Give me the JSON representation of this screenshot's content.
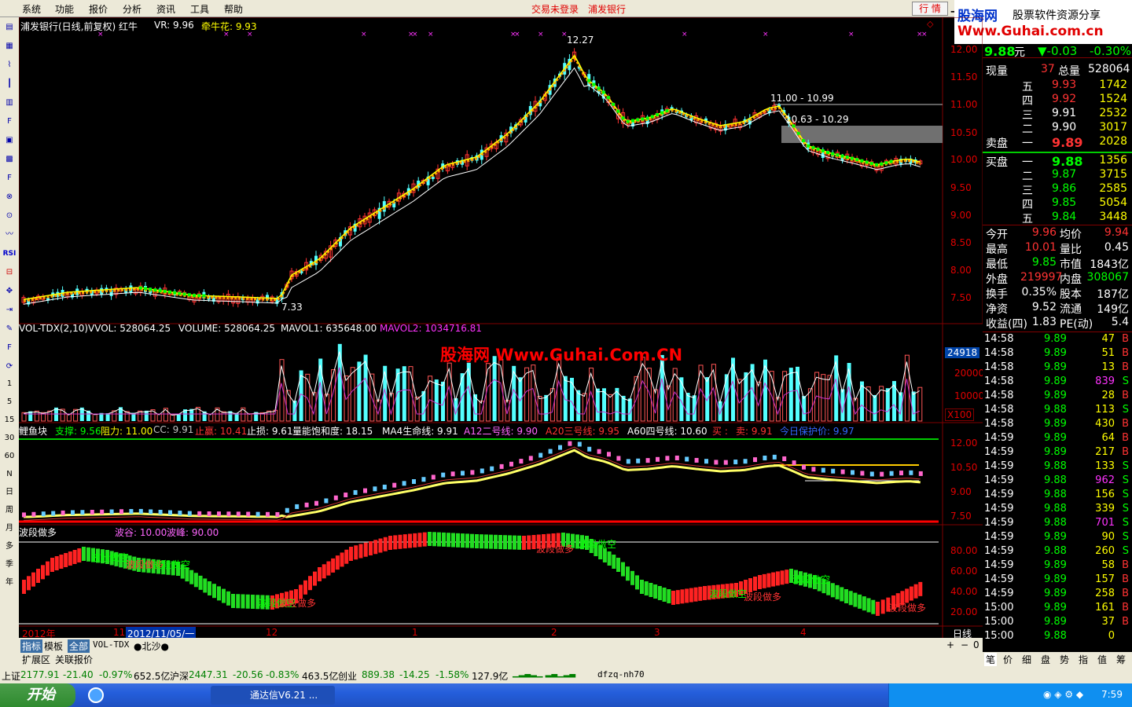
{
  "menu": {
    "items": [
      "系统",
      "功能",
      "报价",
      "分析",
      "资讯",
      "工具",
      "帮助"
    ],
    "status1": "交易未登录",
    "status2": "浦发银行",
    "hq": "行 情"
  },
  "logo": {
    "name": "股海网",
    "slogan": "股票软件资源分享",
    "url": "Www.Guhai.com.cn"
  },
  "left_toolbar": {
    "rsi": "RSI",
    "periods": [
      "1",
      "5",
      "15",
      "30",
      "60",
      "N",
      "日",
      "周",
      "月",
      "多",
      "季",
      "年"
    ]
  },
  "chart": {
    "title": "浦发银行(日线,前复权) 红牛",
    "vr": "VR: 9.96",
    "qnh": "牵牛花: 9.93",
    "price_axis": [
      "12.00",
      "11.50",
      "11.00",
      "10.50",
      "10.00",
      "9.50",
      "9.00",
      "8.50",
      "8.00",
      "7.50"
    ],
    "high_label": "12.27",
    "low_label": "7.33",
    "level1": "11.00 - 10.99",
    "level2": "10.63 - 10.29",
    "vol_header": [
      "VOL-TDX(2,10)",
      "VVOL: 528064.25",
      "VOLUME: 528064.25",
      "MAVOL1: 635648.00",
      "MAVOL2: 1034716.81"
    ],
    "vol_axis": [
      "20000",
      "10000"
    ],
    "vol_cur": "24918",
    "vol_unit": "X100",
    "watermark": "股海网 Www.Guhai.Com.CN",
    "ind_header": [
      "鲤鱼块",
      "支撑: 9.56",
      "阻力: 11.00",
      "CC: 9.91",
      "止赢: 10.41",
      "止损: 9.61",
      "量能饱和度: 18.15",
      "MA4生命线: 9.91",
      "A12二号线: 9.90",
      "A20三号线: 9.95",
      "A60四号线: 10.60",
      "买 :",
      "卖: 9.91",
      "今日保护价: 9.97"
    ],
    "ind_axis": [
      "12.00",
      "10.50",
      "9.00",
      "7.50"
    ],
    "bd_header": [
      "波段做多",
      "波谷: 10.00",
      "波峰: 90.00"
    ],
    "bd_axis": [
      "80.00",
      "60.00",
      "40.00",
      "20.00"
    ],
    "bd_labels": {
      "sell": "波段做空",
      "buy": "波段做多"
    },
    "dates": [
      "2012年",
      "11",
      "2012/11/05/一",
      "12",
      "1",
      "2",
      "3",
      "4"
    ],
    "period": "日线"
  },
  "tabs": [
    "指标",
    "模板",
    "全部",
    "VOL-TDX",
    "●北沙●"
  ],
  "subtabs": [
    "扩展区",
    "关联报价"
  ],
  "zoom": [
    "+",
    "−",
    "0"
  ],
  "quote": {
    "price": "9.88",
    "unit": "元",
    "change": "▼-0.03",
    "pct": "-0.30%",
    "xianliang_l": "现量",
    "xianliang": "37",
    "zongliang_l": "总量",
    "zongliang": "528064",
    "sell": [
      {
        "l": "五",
        "p": "9.93",
        "v": "1742"
      },
      {
        "l": "四",
        "p": "9.92",
        "v": "1524"
      },
      {
        "l": "三",
        "p": "9.91",
        "v": "2532"
      },
      {
        "l": "二",
        "p": "9.90",
        "v": "3017"
      },
      {
        "l": "一",
        "p": "9.89",
        "v": "2028"
      }
    ],
    "buy": [
      {
        "l": "一",
        "p": "9.88",
        "v": "1356"
      },
      {
        "l": "二",
        "p": "9.87",
        "v": "3715"
      },
      {
        "l": "三",
        "p": "9.86",
        "v": "2585"
      },
      {
        "l": "四",
        "p": "9.85",
        "v": "5054"
      },
      {
        "l": "五",
        "p": "9.84",
        "v": "3448"
      }
    ],
    "sell_label": "卖盘",
    "buy_label": "买盘",
    "stats": [
      {
        "a": "今开",
        "av": "9.96",
        "b": "均价",
        "bv": "9.94"
      },
      {
        "a": "最高",
        "av": "10.01",
        "b": "量比",
        "bv": "0.45"
      },
      {
        "a": "最低",
        "av": "9.85",
        "b": "市值",
        "bv": "1843亿"
      },
      {
        "a": "外盘",
        "av": "219997",
        "b": "内盘",
        "bv": "308067"
      },
      {
        "a": "换手",
        "av": "0.35%",
        "b": "股本",
        "bv": "187亿"
      },
      {
        "a": "净资",
        "av": "9.52",
        "b": "流通",
        "bv": "149亿"
      },
      {
        "a": "收益(四)",
        "av": "1.83",
        "b": "PE(动)",
        "bv": "5.4"
      }
    ],
    "ticks": [
      [
        "14:58",
        "9.89",
        "47",
        "B"
      ],
      [
        "14:58",
        "9.89",
        "51",
        "B"
      ],
      [
        "14:58",
        "9.89",
        "13",
        "B"
      ],
      [
        "14:58",
        "9.89",
        "839",
        "S"
      ],
      [
        "14:58",
        "9.89",
        "28",
        "B"
      ],
      [
        "14:58",
        "9.88",
        "113",
        "S"
      ],
      [
        "14:58",
        "9.89",
        "430",
        "B"
      ],
      [
        "14:59",
        "9.89",
        "64",
        "B"
      ],
      [
        "14:59",
        "9.89",
        "217",
        "B"
      ],
      [
        "14:59",
        "9.88",
        "133",
        "S"
      ],
      [
        "14:59",
        "9.88",
        "962",
        "S"
      ],
      [
        "14:59",
        "9.88",
        "156",
        "S"
      ],
      [
        "14:59",
        "9.88",
        "339",
        "S"
      ],
      [
        "14:59",
        "9.88",
        "701",
        "S"
      ],
      [
        "14:59",
        "9.89",
        "90",
        "S"
      ],
      [
        "14:59",
        "9.88",
        "260",
        "S"
      ],
      [
        "14:59",
        "9.89",
        "58",
        "B"
      ],
      [
        "14:59",
        "9.89",
        "157",
        "B"
      ],
      [
        "14:59",
        "9.89",
        "258",
        "B"
      ],
      [
        "15:00",
        "9.89",
        "161",
        "B"
      ],
      [
        "15:00",
        "9.89",
        "37",
        "B"
      ],
      [
        "15:00",
        "9.88",
        "0",
        ""
      ]
    ],
    "bottom_tabs": [
      "笔",
      "价",
      "细",
      "盘",
      "势",
      "指",
      "值",
      "筹"
    ]
  },
  "index_bar": [
    {
      "n": "上证",
      "v": "2177.91",
      "c": "-21.40",
      "p": "-0.97%",
      "a": "652.5亿"
    },
    {
      "n": "沪深",
      "v": "2447.31",
      "c": "-20.56",
      "p": "-0.83%",
      "a": "463.5亿"
    },
    {
      "n": "创业",
      "v": "889.38",
      "c": "-14.25",
      "p": "-1.58%",
      "a": "127.9亿"
    }
  ],
  "index_extra": "dfzq-nh70",
  "taskbar": {
    "start": "开始",
    "app": "通达信V6.21 ...",
    "time": "7:59"
  }
}
